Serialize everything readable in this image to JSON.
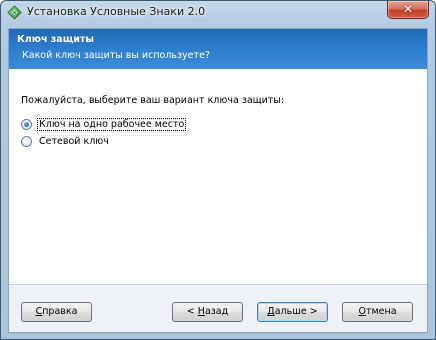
{
  "window": {
    "title": "Установка Условные Знаки 2.0",
    "close_glyph": "✕"
  },
  "header": {
    "title": "Ключ защиты",
    "subtitle": "Какой ключ защиты вы используете?"
  },
  "body": {
    "prompt": "Пожалуйста, выберите ваш вариант ключа защиты:",
    "options": [
      {
        "label": "Ключ на одно рабочее место",
        "selected": true
      },
      {
        "label": "Сетевой ключ",
        "selected": false
      }
    ]
  },
  "buttons": {
    "help": {
      "pre": "",
      "mnemonic": "С",
      "post": "правка"
    },
    "back": {
      "pre": "< ",
      "mnemonic": "Н",
      "post": "азад"
    },
    "next": {
      "pre": "",
      "mnemonic": "Д",
      "post": "альше >"
    },
    "cancel": {
      "pre": "",
      "mnemonic": "О",
      "post": "тмена"
    }
  },
  "colors": {
    "header_band": "#2f80cf",
    "header_text": "#ffffff",
    "close_button": "#c4412b",
    "window_frame": "#b6cde3"
  },
  "icons": {
    "app": "installer-app-icon",
    "close": "close-icon"
  }
}
